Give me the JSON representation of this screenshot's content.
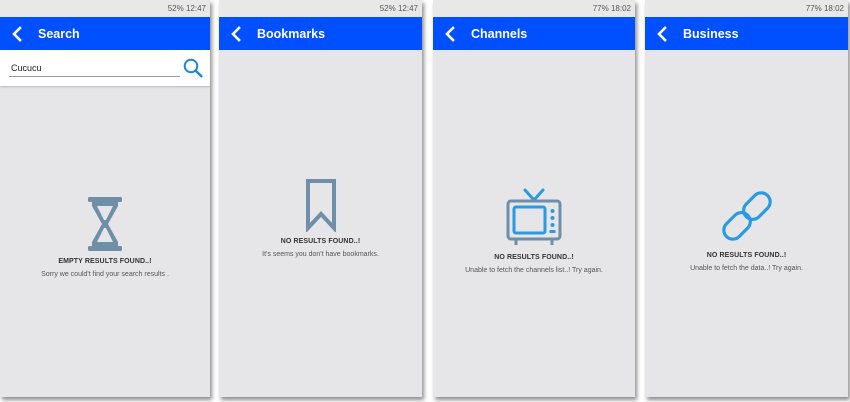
{
  "colors": {
    "appbar": "#0050ff",
    "screen_bg": "#e6e6e8",
    "icon_slate": "#6f8fa8",
    "icon_blue": "#2a9be0",
    "search_blue": "#1e88d8"
  },
  "screens": [
    {
      "status_text": "52% 12:47",
      "title": "Search",
      "search": {
        "value": "Cucucu",
        "placeholder": ""
      },
      "icon": "hourglass-icon",
      "heading": "EMPTY RESULTS FOUND..!",
      "message": "Sorry we could't find your search results ."
    },
    {
      "status_text": "52% 12:47",
      "title": "Bookmarks",
      "icon": "bookmark-icon",
      "heading": "NO RESULTS FOUND..!",
      "message": "It's seems you don't have bookmarks."
    },
    {
      "status_text": "77% 18:02",
      "title": "Channels",
      "icon": "tv-icon",
      "heading": "NO RESULTS FOUND..!",
      "message": "Unable to fetch the channels list..! Try again."
    },
    {
      "status_text": "77% 18:02",
      "title": "Business",
      "icon": "link-icon",
      "heading": "NO RESULTS FOUND..!",
      "message": "Unable to fetch the data..! Try again."
    }
  ]
}
